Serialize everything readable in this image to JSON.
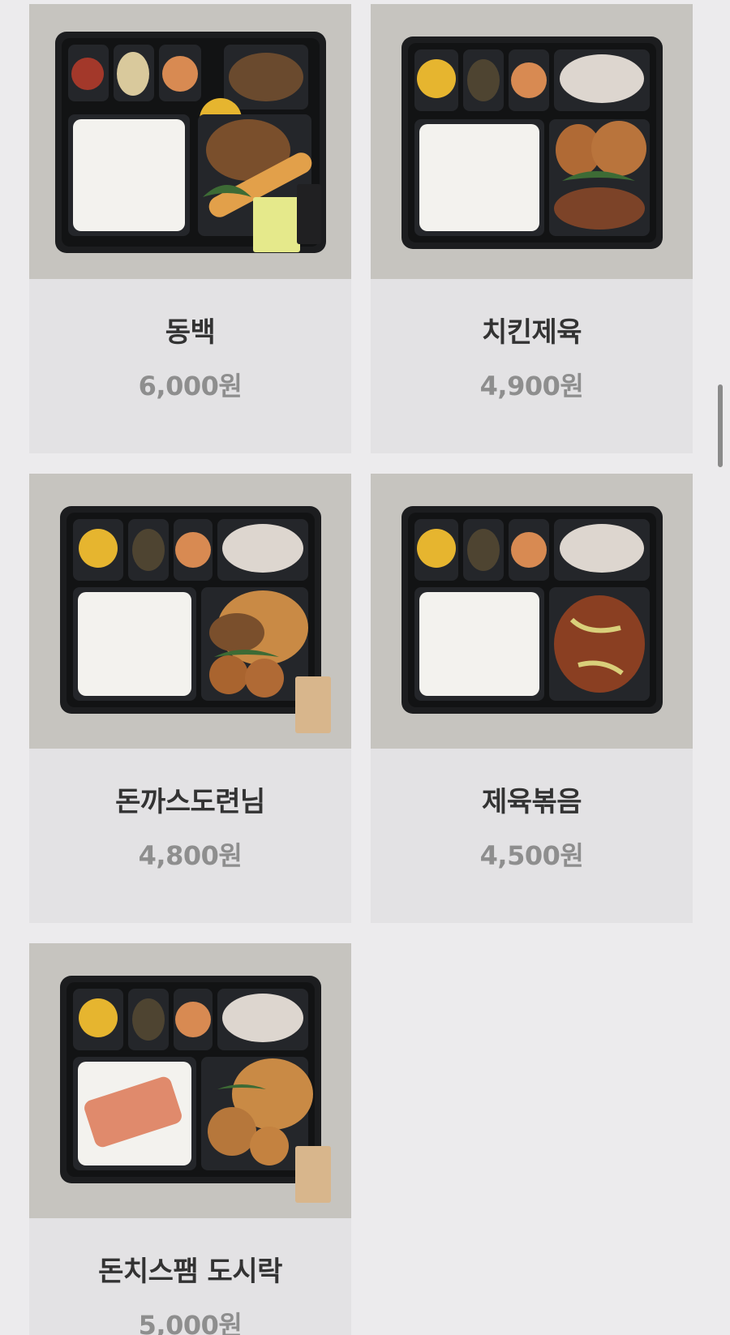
{
  "products": [
    {
      "name": "동백",
      "price": "6,000원",
      "image": "dongbaek-lunchbox-photo"
    },
    {
      "name": "치킨제육",
      "price": "4,900원",
      "image": "chicken-jeyuk-lunchbox-photo"
    },
    {
      "name": "돈까스도련님",
      "price": "4,800원",
      "image": "donkatsu-doryeonnim-lunchbox-photo"
    },
    {
      "name": "제육볶음",
      "price": "4,500원",
      "image": "jeyuk-bokkeum-lunchbox-photo"
    },
    {
      "name": "돈치스팸 도시락",
      "price": "5,000원",
      "image": "donchi-spam-lunchbox-photo"
    }
  ],
  "colors": {
    "page_background": "#ecebed",
    "card_background": "#e3e2e4",
    "photo_background": "#c6c4bf",
    "name_text": "#333333",
    "price_text": "#8e8e8e"
  }
}
